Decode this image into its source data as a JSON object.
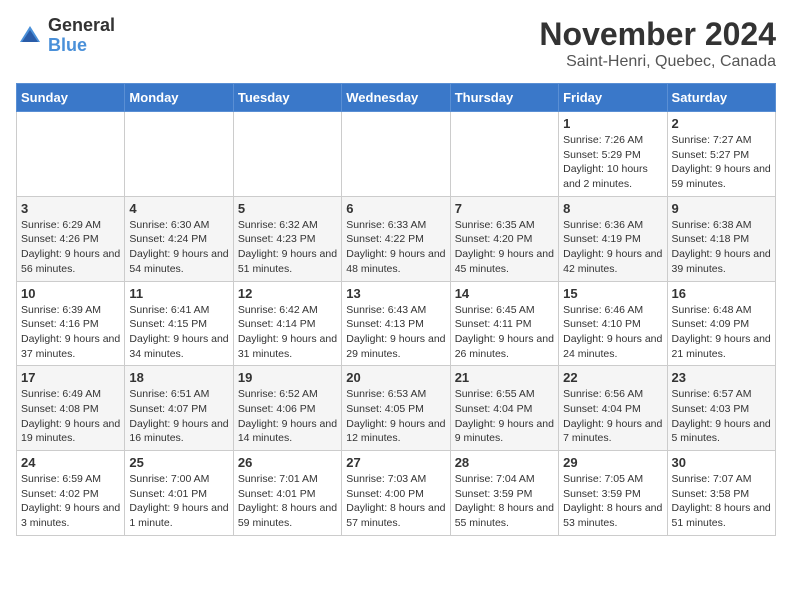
{
  "logo": {
    "general": "General",
    "blue": "Blue"
  },
  "title": "November 2024",
  "location": "Saint-Henri, Quebec, Canada",
  "days_header": [
    "Sunday",
    "Monday",
    "Tuesday",
    "Wednesday",
    "Thursday",
    "Friday",
    "Saturday"
  ],
  "weeks": [
    [
      {
        "day": "",
        "info": ""
      },
      {
        "day": "",
        "info": ""
      },
      {
        "day": "",
        "info": ""
      },
      {
        "day": "",
        "info": ""
      },
      {
        "day": "",
        "info": ""
      },
      {
        "day": "1",
        "info": "Sunrise: 7:26 AM\nSunset: 5:29 PM\nDaylight: 10 hours and 2 minutes."
      },
      {
        "day": "2",
        "info": "Sunrise: 7:27 AM\nSunset: 5:27 PM\nDaylight: 9 hours and 59 minutes."
      }
    ],
    [
      {
        "day": "3",
        "info": "Sunrise: 6:29 AM\nSunset: 4:26 PM\nDaylight: 9 hours and 56 minutes."
      },
      {
        "day": "4",
        "info": "Sunrise: 6:30 AM\nSunset: 4:24 PM\nDaylight: 9 hours and 54 minutes."
      },
      {
        "day": "5",
        "info": "Sunrise: 6:32 AM\nSunset: 4:23 PM\nDaylight: 9 hours and 51 minutes."
      },
      {
        "day": "6",
        "info": "Sunrise: 6:33 AM\nSunset: 4:22 PM\nDaylight: 9 hours and 48 minutes."
      },
      {
        "day": "7",
        "info": "Sunrise: 6:35 AM\nSunset: 4:20 PM\nDaylight: 9 hours and 45 minutes."
      },
      {
        "day": "8",
        "info": "Sunrise: 6:36 AM\nSunset: 4:19 PM\nDaylight: 9 hours and 42 minutes."
      },
      {
        "day": "9",
        "info": "Sunrise: 6:38 AM\nSunset: 4:18 PM\nDaylight: 9 hours and 39 minutes."
      }
    ],
    [
      {
        "day": "10",
        "info": "Sunrise: 6:39 AM\nSunset: 4:16 PM\nDaylight: 9 hours and 37 minutes."
      },
      {
        "day": "11",
        "info": "Sunrise: 6:41 AM\nSunset: 4:15 PM\nDaylight: 9 hours and 34 minutes."
      },
      {
        "day": "12",
        "info": "Sunrise: 6:42 AM\nSunset: 4:14 PM\nDaylight: 9 hours and 31 minutes."
      },
      {
        "day": "13",
        "info": "Sunrise: 6:43 AM\nSunset: 4:13 PM\nDaylight: 9 hours and 29 minutes."
      },
      {
        "day": "14",
        "info": "Sunrise: 6:45 AM\nSunset: 4:11 PM\nDaylight: 9 hours and 26 minutes."
      },
      {
        "day": "15",
        "info": "Sunrise: 6:46 AM\nSunset: 4:10 PM\nDaylight: 9 hours and 24 minutes."
      },
      {
        "day": "16",
        "info": "Sunrise: 6:48 AM\nSunset: 4:09 PM\nDaylight: 9 hours and 21 minutes."
      }
    ],
    [
      {
        "day": "17",
        "info": "Sunrise: 6:49 AM\nSunset: 4:08 PM\nDaylight: 9 hours and 19 minutes."
      },
      {
        "day": "18",
        "info": "Sunrise: 6:51 AM\nSunset: 4:07 PM\nDaylight: 9 hours and 16 minutes."
      },
      {
        "day": "19",
        "info": "Sunrise: 6:52 AM\nSunset: 4:06 PM\nDaylight: 9 hours and 14 minutes."
      },
      {
        "day": "20",
        "info": "Sunrise: 6:53 AM\nSunset: 4:05 PM\nDaylight: 9 hours and 12 minutes."
      },
      {
        "day": "21",
        "info": "Sunrise: 6:55 AM\nSunset: 4:04 PM\nDaylight: 9 hours and 9 minutes."
      },
      {
        "day": "22",
        "info": "Sunrise: 6:56 AM\nSunset: 4:04 PM\nDaylight: 9 hours and 7 minutes."
      },
      {
        "day": "23",
        "info": "Sunrise: 6:57 AM\nSunset: 4:03 PM\nDaylight: 9 hours and 5 minutes."
      }
    ],
    [
      {
        "day": "24",
        "info": "Sunrise: 6:59 AM\nSunset: 4:02 PM\nDaylight: 9 hours and 3 minutes."
      },
      {
        "day": "25",
        "info": "Sunrise: 7:00 AM\nSunset: 4:01 PM\nDaylight: 9 hours and 1 minute."
      },
      {
        "day": "26",
        "info": "Sunrise: 7:01 AM\nSunset: 4:01 PM\nDaylight: 8 hours and 59 minutes."
      },
      {
        "day": "27",
        "info": "Sunrise: 7:03 AM\nSunset: 4:00 PM\nDaylight: 8 hours and 57 minutes."
      },
      {
        "day": "28",
        "info": "Sunrise: 7:04 AM\nSunset: 3:59 PM\nDaylight: 8 hours and 55 minutes."
      },
      {
        "day": "29",
        "info": "Sunrise: 7:05 AM\nSunset: 3:59 PM\nDaylight: 8 hours and 53 minutes."
      },
      {
        "day": "30",
        "info": "Sunrise: 7:07 AM\nSunset: 3:58 PM\nDaylight: 8 hours and 51 minutes."
      }
    ]
  ]
}
